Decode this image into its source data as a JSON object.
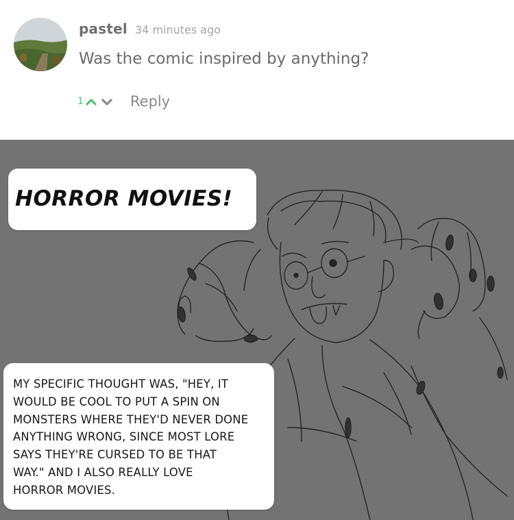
{
  "comment": {
    "username": "pastel",
    "timestamp": "34 minutes ago",
    "text": "Was the comic inspired by anything?",
    "vote_count": "1",
    "reply_label": "Reply",
    "upvote_icon": "chevron-up-icon",
    "downvote_icon": "chevron-down-icon",
    "colors": {
      "vote_green": "#55c07a",
      "text_gray": "#6a6a6a"
    }
  },
  "comic": {
    "bubble_top": "HORROR MOVIES!",
    "bubble_bottom": "MY SPECIFIC THOUGHT WAS, \"HEY, IT\nWOULD BE COOL TO PUT A SPIN ON\nMONSTERS WHERE THEY'D NEVER DONE\nANYTHING WRONG, SINCE MOST LORE\nSAYS THEY'RE CURSED TO BE THAT\nWAY.\" AND I ALSO REALLY LOVE\nHORROR MOVIES.",
    "background_color": "#737373"
  }
}
